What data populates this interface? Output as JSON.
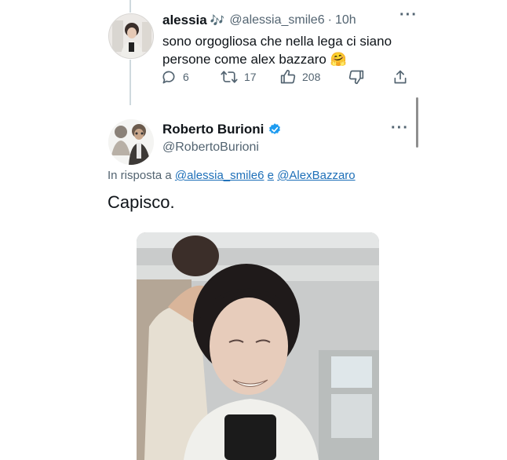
{
  "tweet1": {
    "display_name": "alessia",
    "name_emoji": "🎶",
    "handle": "@alessia_smile6",
    "separator": "·",
    "time": "10h",
    "text_line1": "sono orgogliosa che nella lega ci siano",
    "text_line2": "persone come alex bazzaro 🤗",
    "more": "···",
    "replies": "6",
    "retweets": "17",
    "likes": "208"
  },
  "tweet2": {
    "display_name": "Roberto Burioni",
    "handle": "@RobertoBurioni",
    "more": "···",
    "reply_prefix": "In risposta a",
    "reply_user1": "@alessia_smile6",
    "reply_conjunction": "e",
    "reply_user2": "@AlexBazzaro",
    "text": "Capisco."
  },
  "colors": {
    "secondary_text": "#536471",
    "link": "#1d6fb8",
    "verified": "#1d9bf0",
    "thread_line": "#cfd9de"
  },
  "icons": [
    "reply-icon",
    "retweet-icon",
    "like-icon",
    "dislike-icon",
    "share-icon",
    "verified-badge-icon"
  ]
}
